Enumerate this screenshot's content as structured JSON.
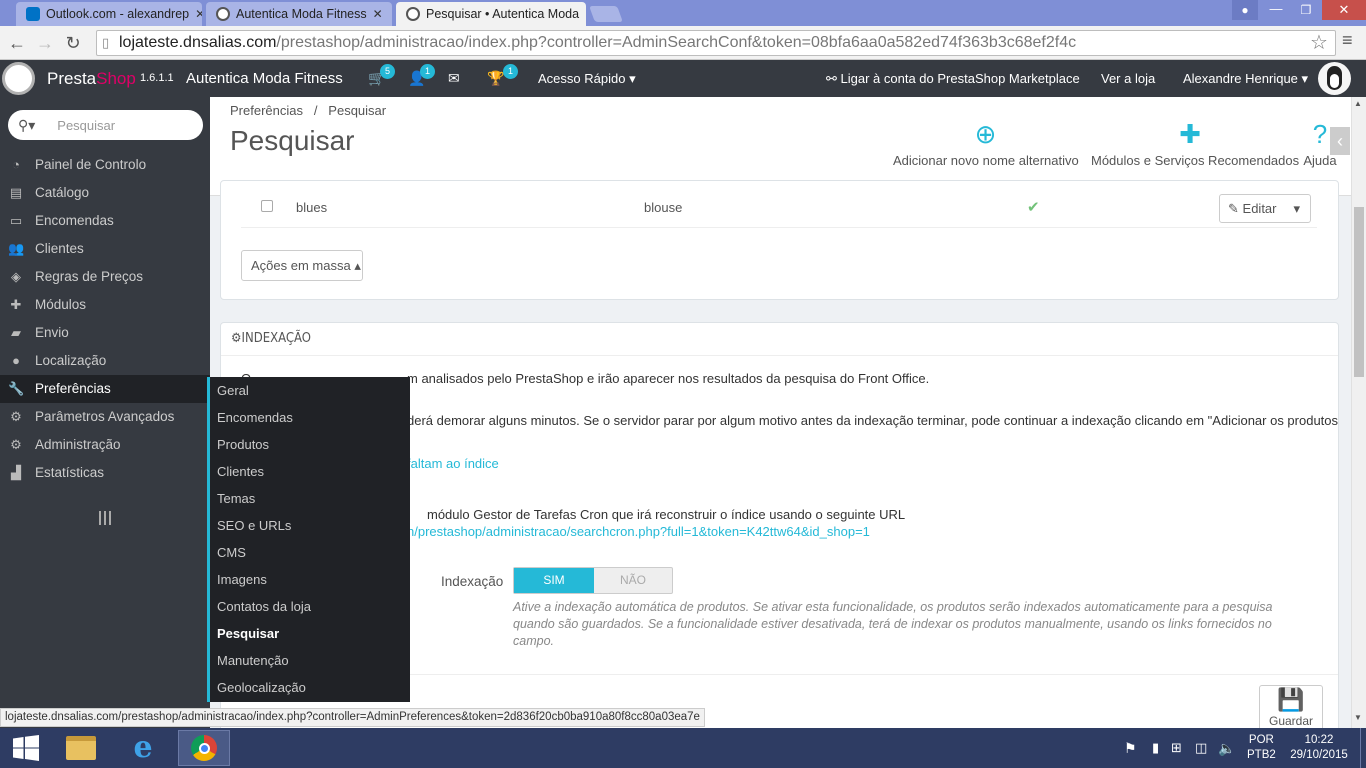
{
  "browser": {
    "tabs": [
      {
        "label": "Outlook.com - alexandrep",
        "active": false
      },
      {
        "label": "Autentica Moda Fitness",
        "active": false
      },
      {
        "label": "Pesquisar • Autentica Moda",
        "active": true
      }
    ],
    "url_host": "lojateste.dnsalias.com",
    "url_path": "/prestashop/administracao/index.php?controller=AdminSearchConf&token=08bfa6aa0a582ed74f363b3c68ef2f4c"
  },
  "header": {
    "brand_pre": "Presta",
    "brand_post": "Shop",
    "version": "1.6.1.1",
    "shop_name": "Autentica Moda Fitness",
    "cart_badge": "5",
    "users_badge": "1",
    "trophy_badge": "1",
    "quick_access": "Acesso Rápido",
    "marketplace": "Ligar à conta do PrestaShop Marketplace",
    "view_shop": "Ver a loja",
    "user_name": "Alexandre Henrique"
  },
  "sidebar": {
    "search_placeholder": "Pesquisar",
    "items": [
      {
        "label": "Painel de Controlo",
        "icon": "dashboard-icon"
      },
      {
        "label": "Catálogo",
        "icon": "book-icon"
      },
      {
        "label": "Encomendas",
        "icon": "credit-card-icon"
      },
      {
        "label": "Clientes",
        "icon": "users-icon"
      },
      {
        "label": "Regras de Preços",
        "icon": "tag-icon"
      },
      {
        "label": "Módulos",
        "icon": "puzzle-icon"
      },
      {
        "label": "Envio",
        "icon": "truck-icon"
      },
      {
        "label": "Localização",
        "icon": "globe-icon"
      },
      {
        "label": "Preferências",
        "icon": "wrench-icon"
      },
      {
        "label": "Parâmetros Avançados",
        "icon": "cogs-icon"
      },
      {
        "label": "Administração",
        "icon": "cog-icon"
      },
      {
        "label": "Estatísticas",
        "icon": "bar-chart-icon"
      }
    ],
    "submenu": [
      "Geral",
      "Encomendas",
      "Produtos",
      "Clientes",
      "Temas",
      "SEO e URLs",
      "CMS",
      "Imagens",
      "Contatos da loja",
      "Pesquisar",
      "Manutenção",
      "Geolocalização"
    ]
  },
  "page": {
    "breadcrumb_1": "Preferências",
    "breadcrumb_sep": "/",
    "breadcrumb_2": "Pesquisar",
    "title": "Pesquisar",
    "toolbar": {
      "add_alias": "Adicionar novo nome alternativo",
      "modules": "Módulos e Serviços Recomendados",
      "help": "Ajuda"
    }
  },
  "alias_table": {
    "row": {
      "alias": "blues",
      "search": "blouse"
    },
    "edit_label": "Editar",
    "bulk_label": "Ações em massa"
  },
  "indexing": {
    "heading": "INDEXAÇÃO",
    "line1_visible": "O",
    "line1": "m analisados pelo PrestaShop e irão aparecer nos resultados da pesquisa do Front Office.",
    "line2": "derá demorar alguns minutos. Se o servidor parar por algum motivo antes da indexação terminar, pode continuar a indexação clicando em \"Adicionar os produtos",
    "link1": "faltam ao índice",
    "cron_text": "módulo Gestor de Tarefas Cron que irá reconstruir o índice usando o seguinte URL",
    "cron_url": "n/prestashop/administracao/searchcron.php?full=1&token=K42ttw64&id_shop=1",
    "toggle_label": "Indexação",
    "toggle_yes": "SIM",
    "toggle_no": "NÃO",
    "help_text": "Ative a indexação automática de produtos. Se ativar esta funcionalidade, os produtos serão indexados automaticamente para a pesquisa quando são guardados. Se a funcionalidade estiver desativada, terá de indexar os produtos manualmente, usando os links fornecidos no campo.",
    "save_label": "Guardar"
  },
  "status_url": "lojateste.dnsalias.com/prestashop/administracao/index.php?controller=AdminPreferences&token=2d836f20cb0ba910a80f8cc80a03ea7e",
  "taskbar": {
    "lang_1": "POR",
    "lang_2": "PTB2",
    "time": "10:22",
    "date": "29/10/2015"
  }
}
